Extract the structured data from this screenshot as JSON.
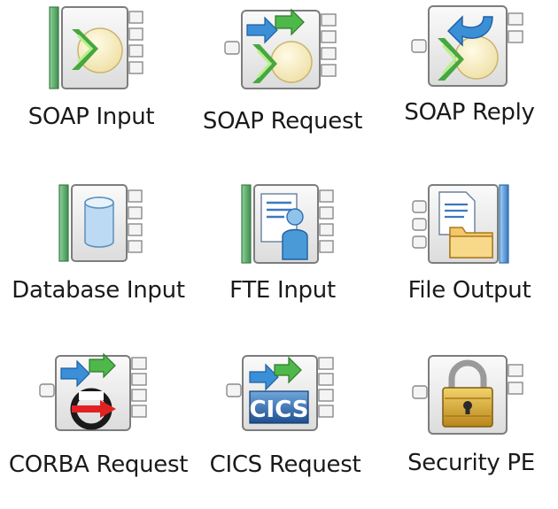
{
  "palette": {
    "nodes": [
      {
        "id": "soap-input",
        "label": "SOAP Input",
        "icon": "soap-input-icon"
      },
      {
        "id": "soap-request",
        "label": "SOAP Request",
        "icon": "soap-request-icon"
      },
      {
        "id": "soap-reply",
        "label": "SOAP Reply",
        "icon": "soap-reply-icon"
      },
      {
        "id": "database-input",
        "label": "Database Input",
        "icon": "database-input-icon"
      },
      {
        "id": "fte-input",
        "label": "FTE Input",
        "icon": "fte-input-icon"
      },
      {
        "id": "file-output",
        "label": "File Output",
        "icon": "file-output-icon"
      },
      {
        "id": "corba-request",
        "label": "CORBA Request",
        "icon": "corba-request-icon"
      },
      {
        "id": "cics-request",
        "label": "CICS Request",
        "icon": "cics-request-icon",
        "icon_text": "CICS"
      },
      {
        "id": "security-pe",
        "label": "Security PE",
        "icon": "security-pe-icon"
      }
    ],
    "colors": {
      "input_bar": "#5aa86a",
      "output_bar": "#5b9bd5",
      "arrow_blue": "#3b8fd6",
      "arrow_green": "#4fb84a",
      "node_border": "#7d7d7d"
    }
  }
}
